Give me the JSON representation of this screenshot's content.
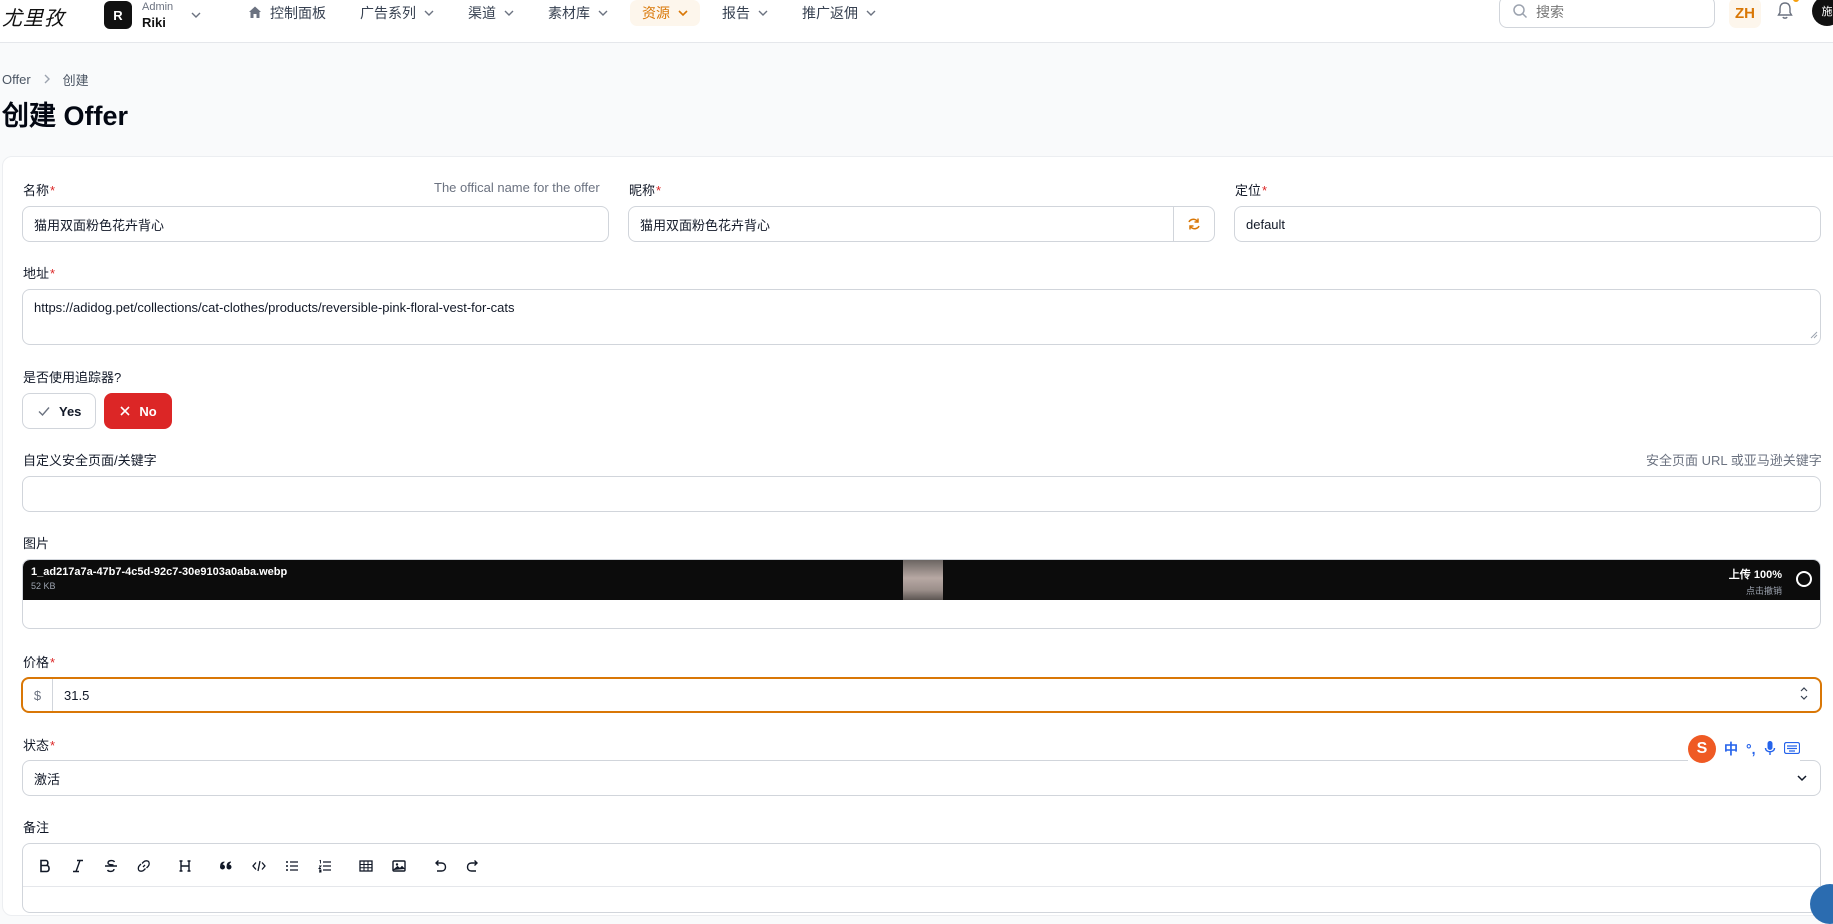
{
  "app": {
    "logo": "尤里孜"
  },
  "tenant": {
    "avatar_letter": "R",
    "role": "Admin",
    "name": "Riki"
  },
  "nav": [
    {
      "label": "控制面板",
      "icon": "home-icon",
      "active": false
    },
    {
      "label": "广告系列",
      "active": false
    },
    {
      "label": "渠道",
      "active": false
    },
    {
      "label": "素材库",
      "active": false
    },
    {
      "label": "资源",
      "active": true
    },
    {
      "label": "报告",
      "active": false
    },
    {
      "label": "推广返佣",
      "active": false
    }
  ],
  "search": {
    "placeholder": "搜索"
  },
  "lang": "ZH",
  "user": {
    "avatar_text": "施"
  },
  "breadcrumb": {
    "parent": "Offer",
    "current": "创建"
  },
  "page": {
    "title": "创建 Offer"
  },
  "form": {
    "name": {
      "label": "名称",
      "hint": "The offical name for the offer",
      "value": "猫用双面粉色花卉背心"
    },
    "nickname": {
      "label": "昵称",
      "value": "猫用双面粉色花卉背心"
    },
    "position": {
      "label": "定位",
      "value": "default"
    },
    "address": {
      "label": "地址",
      "value": "https://adidog.pet/collections/cat-clothes/products/reversible-pink-floral-vest-for-cats"
    },
    "tracker": {
      "label": "是否使用追踪器?",
      "yes": "Yes",
      "no": "No",
      "selected": "No"
    },
    "safe_page": {
      "label": "自定义安全页面/关键字",
      "hint": "安全页面 URL 或亚马逊关键字",
      "value": ""
    },
    "image": {
      "label": "图片",
      "file_name": "1_ad217a7a-47b7-4c5d-92c7-30e9103a0aba.webp",
      "file_size": "52 KB",
      "status": "上传 100%",
      "cancel_hint": "点击撤销",
      "progress": 1.0
    },
    "price": {
      "label": "价格",
      "prefix": "$",
      "value": "31.5"
    },
    "status": {
      "label": "状态",
      "value": "激活"
    },
    "notes": {
      "label": "备注"
    }
  },
  "ime": {
    "logo": "S",
    "mode": "中"
  },
  "colors": {
    "accent": "#d97706",
    "danger": "#dc2626",
    "dark": "#0c0c0c"
  }
}
